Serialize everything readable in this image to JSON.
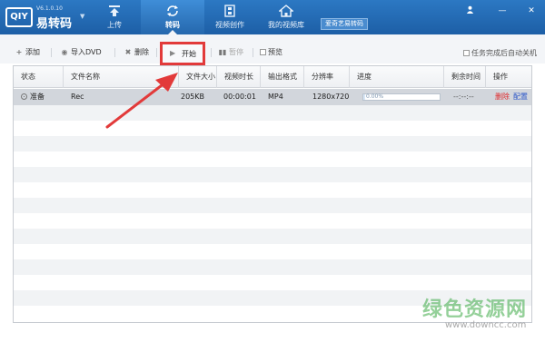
{
  "app": {
    "version": "V6.1.0.10",
    "logo_mark": "QIY",
    "name": "易转码"
  },
  "nav": {
    "tabs": [
      {
        "label": "上传",
        "icon": "upload-icon"
      },
      {
        "label": "转码",
        "icon": "convert-icon",
        "active": true
      },
      {
        "label": "视频创作",
        "icon": "film-icon"
      },
      {
        "label": "我的视频库",
        "icon": "home-icon"
      }
    ],
    "promo": "爱奇艺易转码"
  },
  "window_buttons": {
    "user_icon": "user-icon",
    "minimize_icon": "minimize-icon",
    "close_icon": "close-icon"
  },
  "toolbar": {
    "add": "添加",
    "import_dvd": "导入DVD",
    "delete": "删除",
    "start": "开始",
    "pause": "暂停",
    "preview": "预览",
    "auto_shutdown": "任务完成后自动关机"
  },
  "table": {
    "columns": [
      "状态",
      "文件名称",
      "文件大小",
      "视频时长",
      "输出格式",
      "分辨率",
      "进度",
      "剩余时间",
      "操作"
    ],
    "rows": [
      {
        "status": "准备",
        "filename": "Rec",
        "size": "205KB",
        "duration": "00:00:01",
        "format": "MP4",
        "resolution": "1280x720",
        "progress_text": "0.00%",
        "progress": 0.02,
        "remaining": "--:--:--",
        "op_delete": "删除",
        "op_config": "配置"
      }
    ]
  },
  "colors": {
    "titlebar": "#1d5fa6",
    "highlight_box": "#e23a3a",
    "delete_link": "#e0282a",
    "config_link": "#2a55c8"
  },
  "watermark": {
    "title": "绿色资源网",
    "url": "www.downcc.com"
  }
}
